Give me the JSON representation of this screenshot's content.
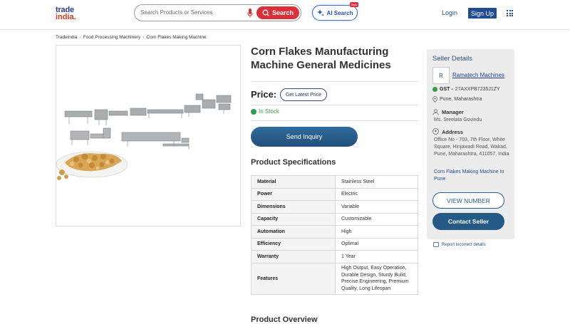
{
  "header": {
    "logo_top": "trade",
    "logo_bottom": "india.",
    "search_placeholder": "Search Products or Services",
    "search_button": "Search",
    "ai_search_button": "AI Search",
    "ai_badge": "New",
    "login": "Login",
    "signup": "Sign Up"
  },
  "breadcrumb": [
    "Tradeindia",
    "Food Processing Machinery",
    "Corn Flakes Making Machine"
  ],
  "product": {
    "title": "Corn Flakes Manufacturing Machine General Medicines",
    "price_label": "Price:",
    "latest_price_button": "Get Latest Price",
    "stock_status": "In Stock",
    "inquiry_button": "Send Inquiry",
    "specs_title": "Product Specifications",
    "specs": [
      {
        "key": "Material",
        "value": "Stainless Steel"
      },
      {
        "key": "Power",
        "value": "Electric"
      },
      {
        "key": "Dimensions",
        "value": "Variable"
      },
      {
        "key": "Capacity",
        "value": "Customizable"
      },
      {
        "key": "Automation",
        "value": "High"
      },
      {
        "key": "Efficiency",
        "value": "Optimal"
      },
      {
        "key": "Warranty",
        "value": "1 Year"
      },
      {
        "key": "Features",
        "value": "High Output, Easy Operation, Durable Design, Sturdy Build, Precise Engineering, Premium Quality, Long Lifespan"
      }
    ],
    "overview_title": "Product Overview"
  },
  "seller": {
    "heading": "Seller Details",
    "avatar_letter": "R",
    "name": "Ramatech Machines",
    "gst_label": "GST -",
    "gst_value": "27AXXPB7235J1ZY",
    "location": "Pune, Maharashtra",
    "manager_label": "Manager",
    "manager_name": "Ms. Sreelata Govindu",
    "address_label": "Address",
    "address": "Office No - 703, 7th Floor, White Square, Hinjawadi Road, Wakad, Pune, Maharashtra, 411057, India",
    "category_link": "Corn Flakes Making Machine In Pune",
    "view_number_button": "VIEW NUMBER",
    "contact_button": "Contact Seller",
    "report_link": "Report incorrect details"
  }
}
